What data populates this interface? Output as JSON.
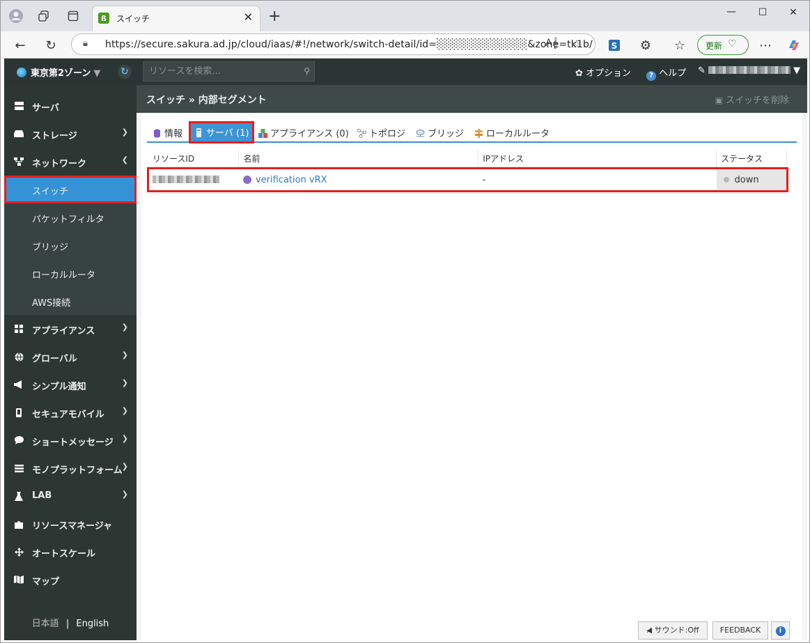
{
  "browser": {
    "tab_title": "スイッチ",
    "url": "https://secure.sakura.ad.jp/cloud/iaas/#!/network/switch-detail/id=░░░░░░░░░░░░&zone=tk1b/",
    "update_label": "更新"
  },
  "header": {
    "zone": "東京第2ゾーン",
    "search_placeholder": "リソースを検索...",
    "options": "オプション",
    "help": "ヘルプ"
  },
  "sidebar": {
    "items": [
      {
        "label": "サーバ"
      },
      {
        "label": "ストレージ"
      },
      {
        "label": "ネットワーク"
      },
      {
        "label": "アプライアンス"
      },
      {
        "label": "グローバル"
      },
      {
        "label": "シンプル通知"
      },
      {
        "label": "セキュアモバイル"
      },
      {
        "label": "ショートメッセージ"
      },
      {
        "label": "モノプラットフォーム"
      },
      {
        "label": "LAB"
      },
      {
        "label": "リソースマネージャ"
      },
      {
        "label": "オートスケール"
      },
      {
        "label": "マップ"
      }
    ],
    "network_sub": [
      "スイッチ",
      "パケットフィルタ",
      "ブリッジ",
      "ローカルルータ",
      "AWS接続"
    ],
    "lang_ja": "日本語",
    "lang_sep": "|",
    "lang_en": "English"
  },
  "main": {
    "breadcrumb": "スイッチ » 内部セグメント",
    "delete_button": "スイッチを削除",
    "tabs": [
      "情報",
      "サーバ (1)",
      "アプライアンス (0)",
      "トポロジ",
      "ブリッジ",
      "ローカルルータ"
    ],
    "columns": [
      "リソースID",
      "名前",
      "IPアドレス",
      "ステータス"
    ],
    "rows": [
      {
        "name": "verification vRX",
        "ip": "-",
        "status": "down"
      }
    ]
  },
  "footer": {
    "sound": "サウンド:Off",
    "feedback": "FEEDBACK",
    "info": "i"
  }
}
